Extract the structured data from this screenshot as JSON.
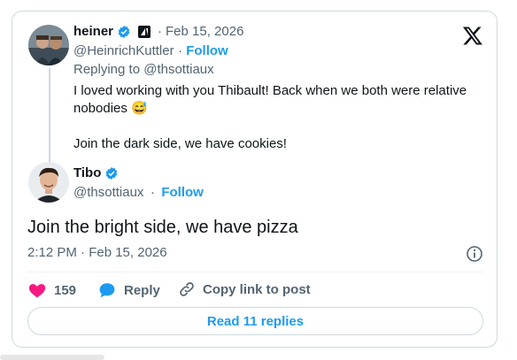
{
  "quoted": {
    "name": "heiner",
    "handle": "@HeinrichKuttler",
    "separator": "·",
    "date": "Feb 15, 2026",
    "follow": "Follow",
    "replying_prefix": "Replying to ",
    "replying_handle": "@thsottiaux",
    "text_line1": "I loved working with you Thibault! Back when we both were relative",
    "text_line2": "nobodies",
    "emoji": "😅",
    "text_line3": "Join the dark side, we have cookies!"
  },
  "main": {
    "name": "Tibo",
    "handle": "@thsottiaux",
    "separator": "·",
    "follow": "Follow",
    "text": "Join the bright side, we have pizza",
    "timestamp": "2:12 PM · Feb 15, 2026"
  },
  "actions": {
    "likes": "159",
    "reply": "Reply",
    "copy_link": "Copy link to post"
  },
  "read_replies": "Read 11 replies",
  "colors": {
    "accent": "#1d9bf0",
    "like": "#f91880",
    "text": "#0f1419",
    "muted": "#536471"
  }
}
